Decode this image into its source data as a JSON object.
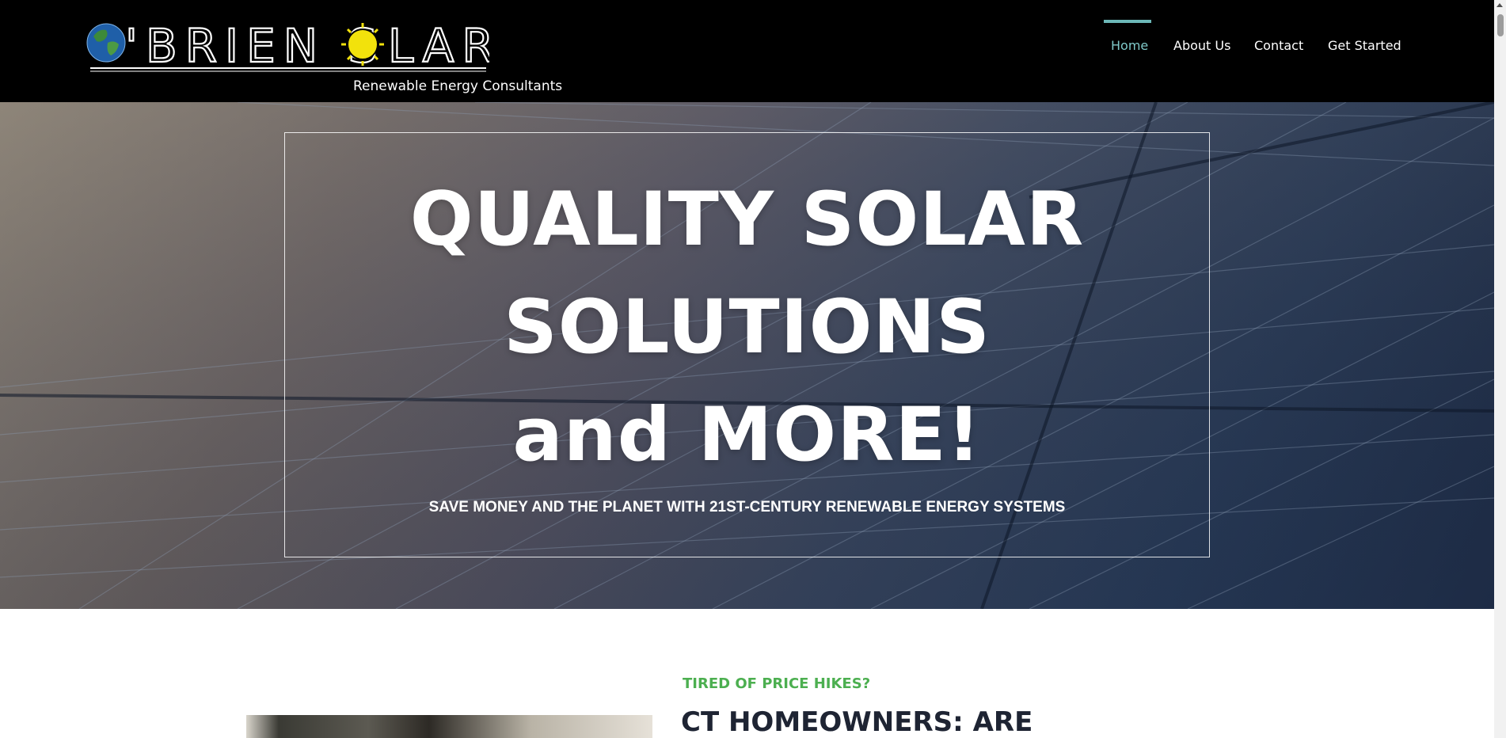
{
  "brand": {
    "name": "O'BRIEN SOLAR",
    "name_part1": "'BRIEN S",
    "name_part2": "LAR",
    "tagline": "Renewable Energy Consultants"
  },
  "nav": {
    "items": [
      {
        "label": "Home",
        "active": true
      },
      {
        "label": "About Us",
        "active": false
      },
      {
        "label": "Contact",
        "active": false
      },
      {
        "label": "Get Started",
        "active": false
      }
    ]
  },
  "hero": {
    "title_line1": "QUALITY SOLAR",
    "title_line2": "SOLUTIONS",
    "title_line3": "and MORE!",
    "subtitle": "SAVE MONEY AND THE PLANET WITH 21ST-CENTURY RENEWABLE ENERGY SYSTEMS"
  },
  "content": {
    "eyebrow": "TIRED OF PRICE HIKES?",
    "heading": "CT HOMEOWNERS: ARE"
  },
  "colors": {
    "header_bg": "#000000",
    "nav_active": "#7fc9c9",
    "nav_indicator": "#6cb8b8",
    "eyebrow": "#4caf50",
    "heading": "#1e2433",
    "sun": "#f2e20c"
  },
  "icons": {
    "globe": "globe-icon",
    "sun": "sun-icon"
  }
}
